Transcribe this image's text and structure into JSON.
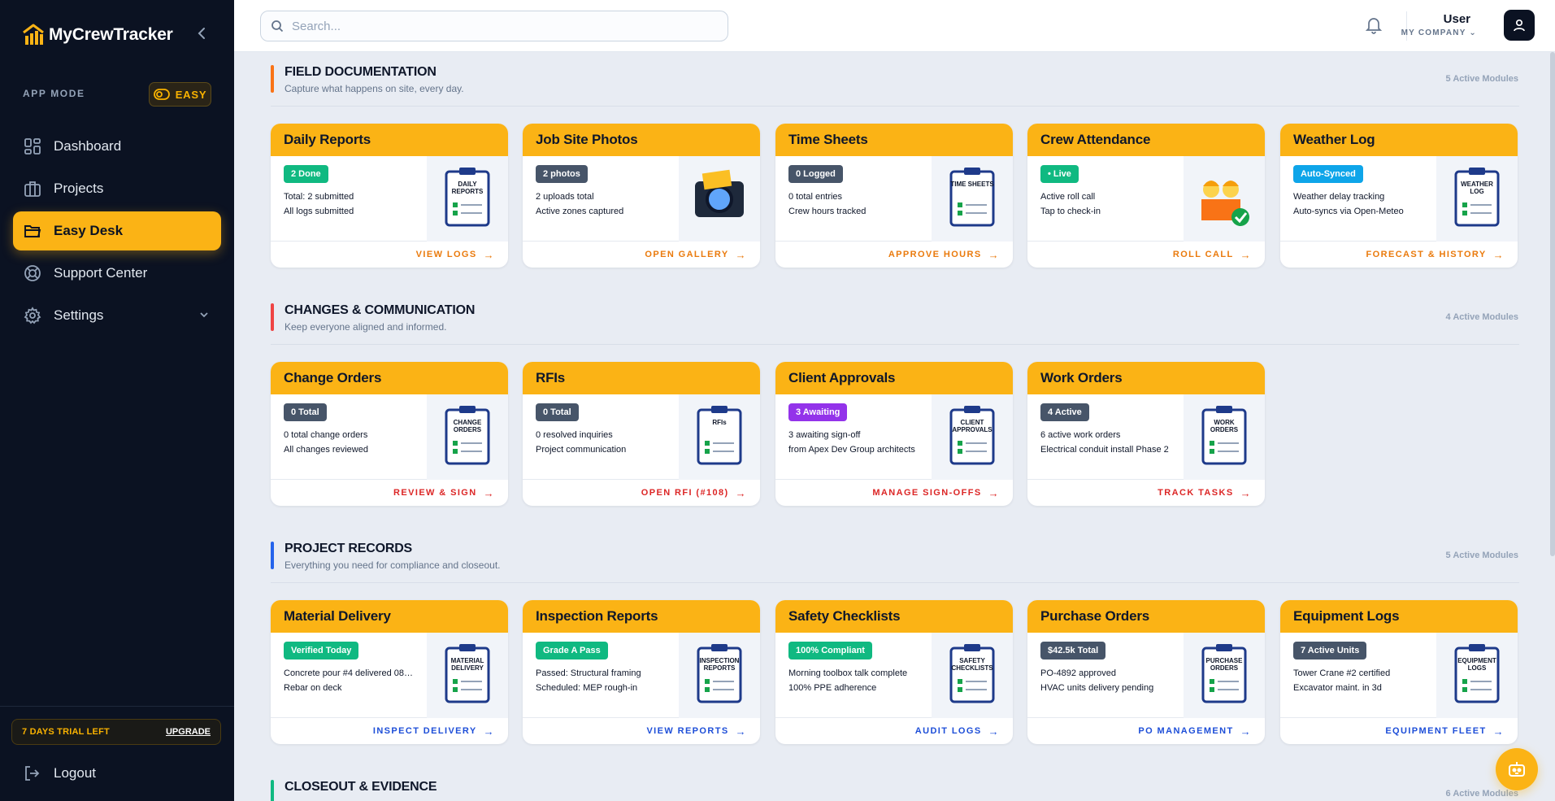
{
  "app": {
    "brand_name": "MyCrewTracker",
    "app_mode_label": "APP MODE",
    "mode_badge": "EASY",
    "collapse_icon": "chevron-left-icon"
  },
  "nav": [
    {
      "label": "Dashboard",
      "icon": "dashboard-icon",
      "active": false
    },
    {
      "label": "Projects",
      "icon": "briefcase-icon",
      "active": false
    },
    {
      "label": "Easy Desk",
      "icon": "folder-icon",
      "active": true
    },
    {
      "label": "Support Center",
      "icon": "lifebuoy-icon",
      "active": false
    },
    {
      "label": "Settings",
      "icon": "gear-icon",
      "active": false
    }
  ],
  "trial": {
    "text": "7 DAYS TRIAL LEFT",
    "upgrade": "UPGRADE"
  },
  "logout": "Logout",
  "topbar": {
    "search_placeholder": "Search...",
    "user_name": "User",
    "company": "MY COMPANY"
  },
  "colors": {
    "accent": "#fbb315",
    "sidebar": "#0b1222",
    "green": "#10b981",
    "slate": "#475569",
    "purple": "#9333ea",
    "orange_link": "#ea7a0c",
    "red_link": "#dc2626",
    "blue_link": "#1d4ed8"
  },
  "sections": [
    {
      "title": "FIELD DOCUMENTATION",
      "subtitle": "Capture what happens on site, every day.",
      "count": "5 Active Modules",
      "bar_color": "#f97316",
      "link_color": "#ea7a0c",
      "cards": [
        {
          "title": "Daily Reports",
          "badge": "2 Done",
          "badge_color": "#10b981",
          "line1": "Total: 2 submitted",
          "line2": "All logs submitted",
          "action": "VIEW LOGS",
          "icon": "daily-reports-icon",
          "art": "DAILY\nREPORTS"
        },
        {
          "title": "Job Site Photos",
          "badge": "2 photos",
          "badge_color": "#475569",
          "line1": "2 uploads total",
          "line2": "Active zones captured",
          "action": "OPEN GALLERY",
          "icon": "camera-icon",
          "art": ""
        },
        {
          "title": "Time Sheets",
          "badge": "0 Logged",
          "badge_color": "#475569",
          "line1": "0 total entries",
          "line2": "Crew hours tracked",
          "action": "APPROVE HOURS",
          "icon": "time-sheets-icon",
          "art": "TIME SHEETS"
        },
        {
          "title": "Crew Attendance",
          "badge": "• Live",
          "badge_color": "#10b981",
          "line1": "Active roll call",
          "line2": "Tap to check-in",
          "action": "ROLL CALL",
          "icon": "crew-icon",
          "art": ""
        },
        {
          "title": "Weather Log",
          "badge": "Auto-Synced",
          "badge_color": "#0ea5e9",
          "line1": "Weather delay tracking",
          "line2": "Auto-syncs via Open-Meteo",
          "action": "FORECAST & HISTORY",
          "icon": "weather-log-icon",
          "art": "WEATHER\nLOG"
        }
      ]
    },
    {
      "title": "CHANGES & COMMUNICATION",
      "subtitle": "Keep everyone aligned and informed.",
      "count": "4 Active Modules",
      "bar_color": "#ef4444",
      "link_color": "#dc2626",
      "cards": [
        {
          "title": "Change Orders",
          "badge": "0 Total",
          "badge_color": "#475569",
          "line1": "0 total change orders",
          "line2": "All changes reviewed",
          "action": "REVIEW & SIGN",
          "icon": "change-orders-icon",
          "art": "CHANGE\nORDERS"
        },
        {
          "title": "RFIs",
          "badge": "0 Total",
          "badge_color": "#475569",
          "line1": "0 resolved inquiries",
          "line2": "Project communication",
          "action": "OPEN RFI (#108)",
          "icon": "rfi-icon",
          "art": "RFIs"
        },
        {
          "title": "Client Approvals",
          "badge": "3 Awaiting",
          "badge_color": "#9333ea",
          "line1": "3 awaiting sign-off",
          "line2": "from Apex Dev Group architects",
          "action": "MANAGE SIGN-OFFS",
          "icon": "client-approvals-icon",
          "art": "CLIENT\nAPPROVALS"
        },
        {
          "title": "Work Orders",
          "badge": "4 Active",
          "badge_color": "#475569",
          "line1": "6 active work orders",
          "line2": "Electrical conduit install Phase 2",
          "action": "TRACK TASKS",
          "icon": "work-orders-icon",
          "art": "WORK\nORDERS"
        }
      ]
    },
    {
      "title": "PROJECT RECORDS",
      "subtitle": "Everything you need for compliance and closeout.",
      "count": "5 Active Modules",
      "bar_color": "#2563eb",
      "link_color": "#1d4ed8",
      "cards": [
        {
          "title": "Material Delivery",
          "badge": "Verified Today",
          "badge_color": "#10b981",
          "line1": "Concrete pour #4 delivered 08:...",
          "line2": "Rebar on deck",
          "action": "INSPECT DELIVERY",
          "icon": "delivery-truck-icon",
          "art": "MATERIAL\nDELIVERY"
        },
        {
          "title": "Inspection Reports",
          "badge": "Grade A Pass",
          "badge_color": "#10b981",
          "line1": "Passed: Structural framing",
          "line2": "Scheduled: MEP rough-in",
          "action": "VIEW REPORTS",
          "icon": "inspection-reports-icon",
          "art": "INSPECTION\nREPORTS"
        },
        {
          "title": "Safety Checklists",
          "badge": "100% Compliant",
          "badge_color": "#10b981",
          "line1": "Morning toolbox talk complete",
          "line2": "100% PPE adherence",
          "action": "AUDIT LOGS",
          "icon": "safety-checklists-icon",
          "art": "SAFETY\nCHECKLISTS"
        },
        {
          "title": "Purchase Orders",
          "badge": "$42.5k Total",
          "badge_color": "#475569",
          "line1": "PO-4892 approved",
          "line2": "HVAC units delivery pending",
          "action": "PO MANAGEMENT",
          "icon": "purchase-orders-icon",
          "art": "PURCHASE\nORDERS"
        },
        {
          "title": "Equipment Logs",
          "badge": "7 Active Units",
          "badge_color": "#475569",
          "line1": "Tower Crane #2 certified",
          "line2": "Excavator maint. in 3d",
          "action": "EQUIPMENT FLEET",
          "icon": "equipment-logs-icon",
          "art": "EQUIPMENT\nLOGS"
        }
      ]
    },
    {
      "title": "CLOSEOUT & EVIDENCE",
      "subtitle": "",
      "count": "6 Active Modules",
      "bar_color": "#10b981",
      "link_color": "#10b981",
      "cards": []
    }
  ]
}
